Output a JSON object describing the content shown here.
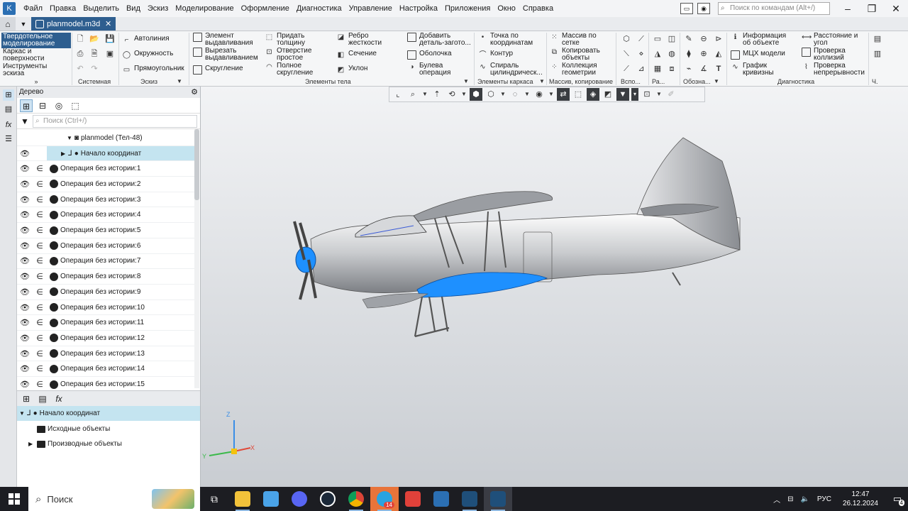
{
  "menubar": {
    "items": [
      "Файл",
      "Правка",
      "Выделить",
      "Вид",
      "Эскиз",
      "Моделирование",
      "Оформление",
      "Диагностика",
      "Управление",
      "Настройка",
      "Приложения",
      "Окно",
      "Справка"
    ],
    "search_placeholder": "Поиск по командам (Alt+/)"
  },
  "tabbar": {
    "doc_name": "planmodel.m3d"
  },
  "ribbon": {
    "modes": [
      "Твердотельное\nмоделирование",
      "Каркас и\nповерхности",
      "Инструменты\nэскиза"
    ],
    "groups": {
      "system": "Системная",
      "sketch": "Эскиз",
      "body": "Элементы тела",
      "frame": "Элементы каркаса",
      "array": "Массив, копирование",
      "aux": "Вспо...",
      "r": "Ра...",
      "notation": "Обозна...",
      "diag": "Диагностика",
      "h": "Ч."
    },
    "sketch_tools": [
      "Автолиния",
      "Окружность",
      "Прямоугольник"
    ],
    "body_tools_1": [
      "Элемент\nвыдавливания",
      "Вырезать\nвыдавливанием",
      "Скругление"
    ],
    "body_tools_2": [
      "Придать\nтолщину",
      "Отверстие\nпростое",
      "Полное\nскругление"
    ],
    "body_tools_3": [
      "Ребро\nжесткости",
      "Сечение",
      "Уклон"
    ],
    "body_tools_4": [
      "Добавить\nдеталь-загото...",
      "Оболочка",
      "Булева\nоперация"
    ],
    "frame_tools": [
      "Точка по\nкоординатам",
      "Контур",
      "Спираль\nцилиндрическ..."
    ],
    "array_tools": [
      "Массив по\nсетке",
      "Копировать\nобъекты",
      "Коллекция\nгеометрии"
    ],
    "diag_tools_1": [
      "Информация\nоб объекте",
      "МЦХ модели",
      "График\nкривизны"
    ],
    "diag_tools_2": [
      "Расстояние и\nугол",
      "Проверка\nколлизий",
      "Проверка\nнепрерывности"
    ]
  },
  "tree": {
    "header": "Дерево",
    "search_placeholder": "Поиск (Ctrl+/)",
    "root": "planmodel (Тел-48)",
    "origin": "Начало координат",
    "operations": [
      "Операция без истории:1",
      "Операция без истории:2",
      "Операция без истории:3",
      "Операция без истории:4",
      "Операция без истории:5",
      "Операция без истории:6",
      "Операция без истории:7",
      "Операция без истории:8",
      "Операция без истории:9",
      "Операция без истории:10",
      "Операция без истории:11",
      "Операция без истории:12",
      "Операция без истории:13",
      "Операция без истории:14",
      "Операция без истории:15"
    ]
  },
  "lower_tree": {
    "origin": "Начало координат",
    "source": "Исходные объекты",
    "derived": "Производные объекты"
  },
  "axes": {
    "x": "X",
    "y": "Y",
    "z": "Z"
  },
  "taskbar": {
    "search_label": "Поиск",
    "badge_count": "14",
    "lang": "РУС",
    "time": "12:47",
    "date": "26.12.2024",
    "notif_count": "4"
  },
  "colors": {
    "accent": "#2e5e8f",
    "selection": "#c4e4f0",
    "highlight_blue": "#1e90ff"
  }
}
